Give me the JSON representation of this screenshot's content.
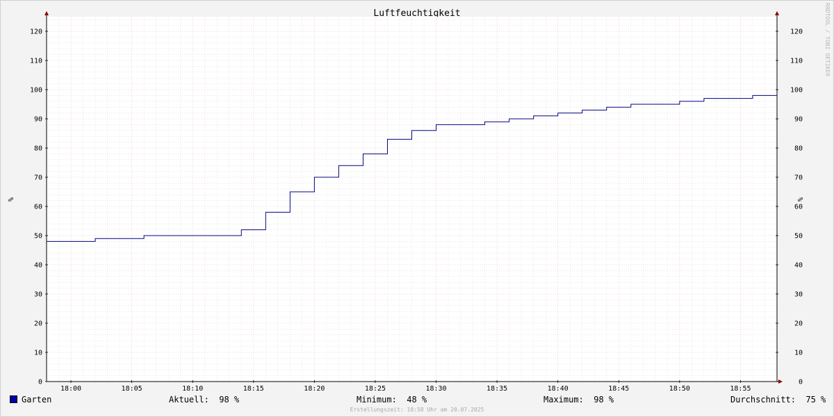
{
  "colors": {
    "series": "#000080",
    "swatch": "#0000aa",
    "plot_bg": "#ffffff",
    "grid_major": "#f0b4b4",
    "grid_minor": "#d2d2d2",
    "axis_arrow": "#880000"
  },
  "watermark": "RRDTOOL / TOBI OETIKER",
  "legend": {
    "series_name": "Garten",
    "current_label": "Aktuell:",
    "current_value": "98 %",
    "min_label": "Minimum:",
    "min_value": "48 %",
    "max_label": "Maximum:",
    "max_value": "98 %",
    "avg_label": "Durchschnitt:",
    "avg_value": "75 %"
  },
  "footer": "Erstellungszeit: 18:58 Uhr am 20.07.2025",
  "chart_data": {
    "type": "line",
    "title": "Luftfeuchtigkeit",
    "ylabel": "%",
    "ylabel_right": "%",
    "xlabel": "",
    "ylim": [
      0,
      125
    ],
    "xlim": [
      "17:58",
      "18:58"
    ],
    "y_ticks": [
      0,
      10,
      20,
      30,
      40,
      50,
      60,
      70,
      80,
      90,
      100,
      110,
      120
    ],
    "x_ticks": [
      "18:00",
      "18:05",
      "18:10",
      "18:15",
      "18:20",
      "18:25",
      "18:30",
      "18:35",
      "18:40",
      "18:45",
      "18:50",
      "18:55"
    ],
    "grid": true,
    "series": [
      {
        "name": "Garten",
        "step": true,
        "x": [
          "17:58",
          "18:02",
          "18:06",
          "18:14",
          "18:16",
          "18:18",
          "18:20",
          "18:22",
          "18:24",
          "18:26",
          "18:28",
          "18:30",
          "18:34",
          "18:36",
          "18:38",
          "18:40",
          "18:42",
          "18:44",
          "18:46",
          "18:50",
          "18:52",
          "18:56"
        ],
        "values": [
          48,
          49,
          50,
          52,
          58,
          65,
          70,
          74,
          78,
          83,
          86,
          88,
          89,
          90,
          91,
          92,
          93,
          94,
          95,
          96,
          97,
          98
        ]
      }
    ]
  }
}
